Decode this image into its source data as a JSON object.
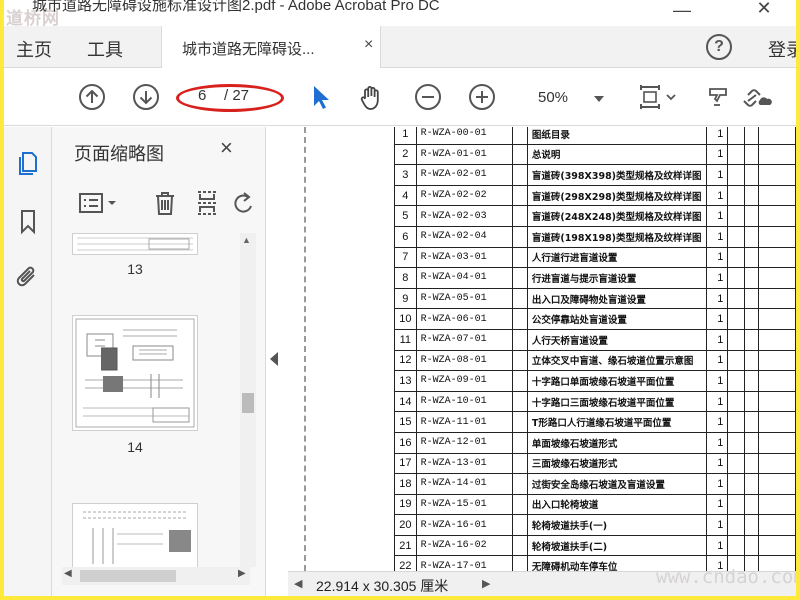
{
  "window": {
    "title": "城市道路无障碍设施标准设计图2.pdf - Adobe Acrobat Pro DC",
    "watermark_logo": "道桥网",
    "minimize_icon": "minimize-icon",
    "close_icon": "close-icon"
  },
  "menu": {
    "home": "主页",
    "tools": "工具",
    "doc_tab": "城市道路无障碍设...",
    "doc_tab_close": "×",
    "help": "?",
    "login": "登录"
  },
  "toolbar": {
    "current_page": "6",
    "total_pages": "/ 27",
    "zoom": "50%",
    "annotation_color": "#d8201d",
    "accent_color": "#1e6fd1"
  },
  "thumbnails": {
    "title": "页面缩略图",
    "close": "×",
    "pages": [
      "13",
      "14"
    ]
  },
  "document": {
    "rows": [
      {
        "no": "1",
        "code": "R-WZA-00-01",
        "name": "图纸目录",
        "count": "1"
      },
      {
        "no": "2",
        "code": "R-WZA-01-01",
        "name": "总说明",
        "count": "1"
      },
      {
        "no": "3",
        "code": "R-WZA-02-01",
        "name": "盲道砖(398X398)类型规格及纹样详图",
        "count": "1"
      },
      {
        "no": "4",
        "code": "R-WZA-02-02",
        "name": "盲道砖(298X298)类型规格及纹样详图",
        "count": "1"
      },
      {
        "no": "5",
        "code": "R-WZA-02-03",
        "name": "盲道砖(248X248)类型规格及纹样详图",
        "count": "1"
      },
      {
        "no": "6",
        "code": "R-WZA-02-04",
        "name": "盲道砖(198X198)类型规格及纹样详图",
        "count": "1"
      },
      {
        "no": "7",
        "code": "R-WZA-03-01",
        "name": "人行道行进盲道设置",
        "count": "1"
      },
      {
        "no": "8",
        "code": "R-WZA-04-01",
        "name": "行进盲道与提示盲道设置",
        "count": "1"
      },
      {
        "no": "9",
        "code": "R-WZA-05-01",
        "name": "出入口及障碍物处盲道设置",
        "count": "1"
      },
      {
        "no": "10",
        "code": "R-WZA-06-01",
        "name": "公交停靠站处盲道设置",
        "count": "1"
      },
      {
        "no": "11",
        "code": "R-WZA-07-01",
        "name": "人行天桥盲道设置",
        "count": "1"
      },
      {
        "no": "12",
        "code": "R-WZA-08-01",
        "name": "立体交叉中盲道、缘石坡道位置示意图",
        "count": "1"
      },
      {
        "no": "13",
        "code": "R-WZA-09-01",
        "name": "十字路口单面坡缘石坡道平面位置",
        "count": "1"
      },
      {
        "no": "14",
        "code": "R-WZA-10-01",
        "name": "十字路口三面坡缘石坡道平面位置",
        "count": "1"
      },
      {
        "no": "15",
        "code": "R-WZA-11-01",
        "name": "T形路口人行道缘石坡道平面位置",
        "count": "1"
      },
      {
        "no": "16",
        "code": "R-WZA-12-01",
        "name": "单面坡缘石坡道形式",
        "count": "1"
      },
      {
        "no": "17",
        "code": "R-WZA-13-01",
        "name": "三面坡缘石坡道形式",
        "count": "1"
      },
      {
        "no": "18",
        "code": "R-WZA-14-01",
        "name": "过街安全岛缘石坡道及盲道设置",
        "count": "1"
      },
      {
        "no": "19",
        "code": "R-WZA-15-01",
        "name": "出入口轮椅坡道",
        "count": "1"
      },
      {
        "no": "20",
        "code": "R-WZA-16-01",
        "name": "轮椅坡道扶手(一)",
        "count": "1"
      },
      {
        "no": "21",
        "code": "R-WZA-16-02",
        "name": "轮椅坡道扶手(二)",
        "count": "1"
      },
      {
        "no": "22",
        "code": "R-WZA-17-01",
        "name": "无障碍机动车停车位",
        "count": "1"
      }
    ]
  },
  "status": {
    "dimensions": "22.914 x 30.305 厘米",
    "watermark": "www.cndao.com"
  }
}
